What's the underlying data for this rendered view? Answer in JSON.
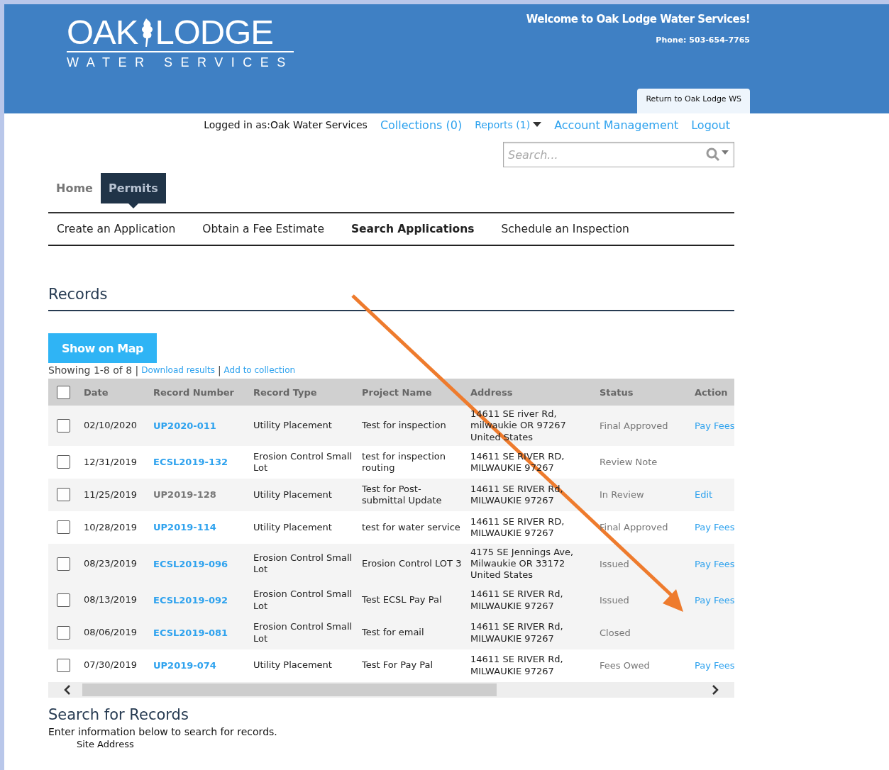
{
  "header": {
    "logo_top": "OAK",
    "logo_top2": "LODGE",
    "logo_bottom": "WATER SERVICES",
    "welcome": "Welcome to Oak Lodge Water Services!",
    "phone": "Phone: 503-654-7765",
    "return_tab": "Return to Oak Lodge WS"
  },
  "account_bar": {
    "logged_in": "Logged in as:Oak Water Services",
    "links": [
      {
        "label": "Collections (0)",
        "kind": "link"
      },
      {
        "label": "Reports (1)",
        "kind": "dropdown"
      },
      {
        "label": "Account Management",
        "kind": "link"
      },
      {
        "label": "Logout",
        "kind": "link"
      }
    ]
  },
  "search": {
    "placeholder": "Search..."
  },
  "tabs": [
    {
      "label": "Home",
      "selected": false
    },
    {
      "label": "Permits",
      "selected": true
    }
  ],
  "subnav": [
    {
      "label": "Create an Application",
      "selected": false
    },
    {
      "label": "Obtain a Fee Estimate",
      "selected": false
    },
    {
      "label": "Search Applications",
      "selected": true
    },
    {
      "label": "Schedule an Inspection",
      "selected": false
    }
  ],
  "records": {
    "title": "Records",
    "map_button": "Show on Map",
    "showing": "Showing 1-8 of 8 |",
    "download": "Download results",
    "separator": "|",
    "add": "Add to collection",
    "select_all": {
      "checked": false
    },
    "columns": [
      "Date",
      "Record Number",
      "Record Type",
      "Project Name",
      "Address",
      "Status",
      "Action"
    ],
    "rows": [
      {
        "checked": false,
        "date": "02/10/2020",
        "number": "UP2020-011",
        "link": true,
        "type": "Utility Placement",
        "project": "Test for inspection",
        "address": "14611 SE river Rd, milwaukie OR 97267 United States",
        "status": "Final Approved",
        "action": "Pay Fees"
      },
      {
        "checked": false,
        "date": "12/31/2019",
        "number": "ECSL2019-132",
        "link": true,
        "type": "Erosion Control Small Lot",
        "project": "test for inspection routing",
        "address": "14611 SE RIVER RD, MILWAUKIE 97267",
        "status": "Review Note"
      },
      {
        "checked": false,
        "date": "11/25/2019",
        "number": "UP2019-128",
        "link": false,
        "type": "Utility Placement",
        "project": "Test for Post-submittal Update",
        "address": "14611 SE RIVER Rd, MILWAUKIE 97267",
        "status": "In Review",
        "action": "Edit"
      },
      {
        "checked": false,
        "date": "10/28/2019",
        "number": "UP2019-114",
        "link": true,
        "type": "Utility Placement",
        "project": "test for water service",
        "address": "14611 SE RIVER RD, MILWAUKIE 97267",
        "status": "Final Approved",
        "action": "Pay Fees"
      },
      {
        "checked": false,
        "date": "08/23/2019",
        "number": "ECSL2019-096",
        "link": true,
        "type": "Erosion Control Small Lot",
        "project": "Erosion Control LOT 3",
        "address": "4175 SE Jennings Ave, Milwaukie OR 33172 United States",
        "status": "Issued",
        "action": "Pay Fees"
      },
      {
        "checked": false,
        "date": "08/13/2019",
        "number": "ECSL2019-092",
        "link": true,
        "type": "Erosion Control Small Lot",
        "project": "Test ECSL Pay Pal",
        "address": "14611 SE RIVER Rd, MILWAUKIE 97267",
        "status": "Issued",
        "action": "Pay Fees"
      },
      {
        "checked": false,
        "date": "08/06/2019",
        "number": "ECSL2019-081",
        "link": true,
        "type": "Erosion Control Small Lot",
        "project": "Test for email",
        "address": "14611 SE RIVER Rd, MILWAUKIE 97267",
        "status": "Closed"
      },
      {
        "checked": false,
        "date": "07/30/2019",
        "number": "UP2019-074",
        "link": true,
        "type": "Utility Placement",
        "project": "Test For Pay Pal",
        "address": "14611 SE RIVER Rd, MILWAUKIE 97267",
        "status": "Fees Owed",
        "action": "Pay Fees"
      }
    ]
  },
  "search_section": {
    "title": "Search for Records",
    "intro": "Enter information below to search for records.",
    "field_label": "Site Address"
  }
}
